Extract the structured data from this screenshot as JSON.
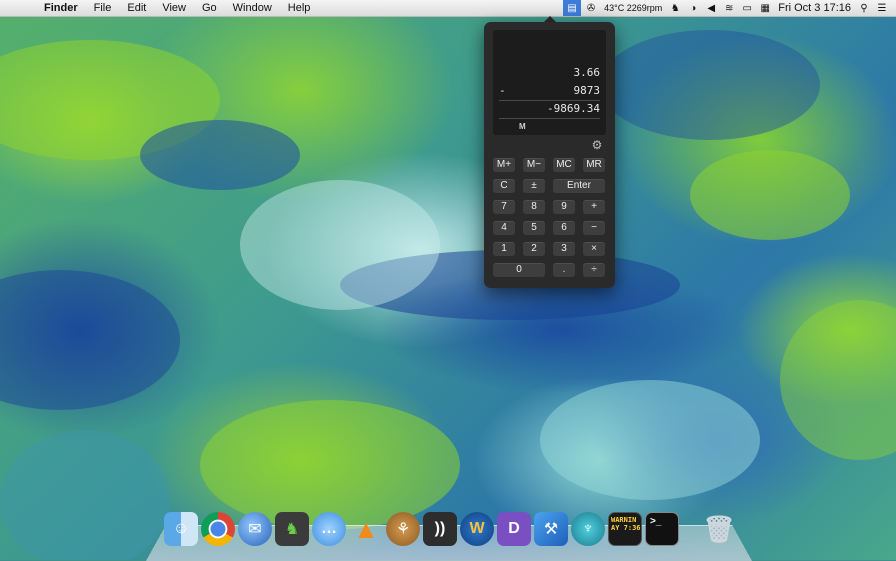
{
  "menubar": {
    "app_name": "Finder",
    "menus": [
      "File",
      "Edit",
      "View",
      "Go",
      "Window",
      "Help"
    ],
    "status": {
      "temperature_fan": "43°C 2269rpm",
      "date_time": "Fri Oct 3  17:16"
    }
  },
  "calculator": {
    "display": {
      "line1_value": "3.66",
      "line2_operator": "-",
      "line2_value": "9873",
      "result": "-9869.34",
      "memory_indicator": "M"
    },
    "keys": {
      "m_plus": "M+",
      "m_minus": "M−",
      "mc": "MC",
      "mr": "MR",
      "clear": "C",
      "plus_minus": "±",
      "enter": "Enter",
      "seven": "7",
      "eight": "8",
      "nine": "9",
      "add": "+",
      "four": "4",
      "five": "5",
      "six": "6",
      "subtract": "−",
      "one": "1",
      "two": "2",
      "three": "3",
      "multiply": "×",
      "zero": "0",
      "decimal": ".",
      "divide": "÷"
    }
  },
  "dock": {
    "console_text": "WARNIN\nAY 7:36"
  },
  "colors": {
    "calc_bg": "#2a2a2a",
    "key_bg": "#3e3e3e",
    "active_menubar": "#3d7bd9"
  }
}
